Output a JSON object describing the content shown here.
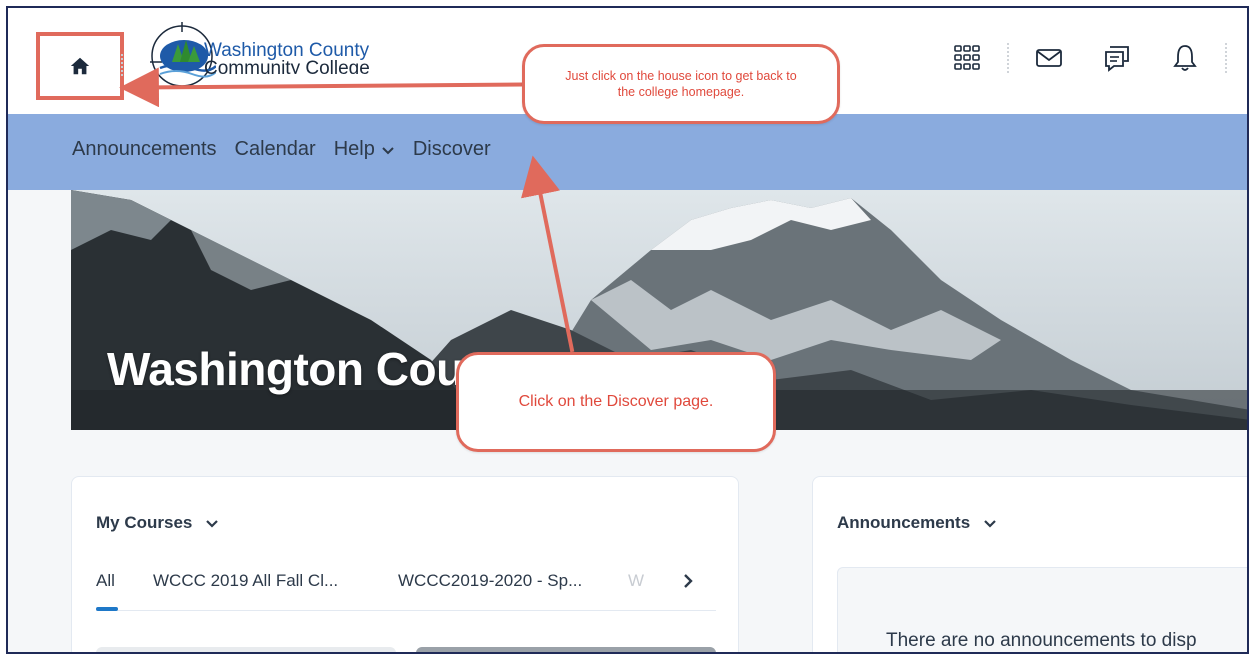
{
  "header": {
    "logo_line1": "Washington County",
    "logo_line2": "Community College",
    "icons": [
      "home-icon",
      "waffle-grid-icon",
      "envelope-icon",
      "chat-bubble-icon",
      "bell-icon"
    ]
  },
  "nav": {
    "items": [
      {
        "label": "Announcements"
      },
      {
        "label": "Calendar"
      },
      {
        "label": "Help",
        "has_dropdown": true
      },
      {
        "label": "Discover"
      }
    ]
  },
  "hero": {
    "title": "Washington Cou"
  },
  "callouts": {
    "home": "Just click on the house icon to get back to the college homepage.",
    "discover": "Click on the Discover page."
  },
  "my_courses": {
    "title": "My Courses",
    "tabs": [
      "All",
      "WCCC 2019 All Fall Cl...",
      "WCCC2019-2020 - Sp...",
      "W"
    ]
  },
  "announcements_widget": {
    "title": "Announcements",
    "empty_message": "There are no announcements to disp"
  },
  "colors": {
    "nav_bg": "#8aabde",
    "callout_border": "#e06a5c",
    "callout_text": "#e0493c",
    "frame_border": "#1f2a58",
    "active_tab": "#1e78c8"
  }
}
